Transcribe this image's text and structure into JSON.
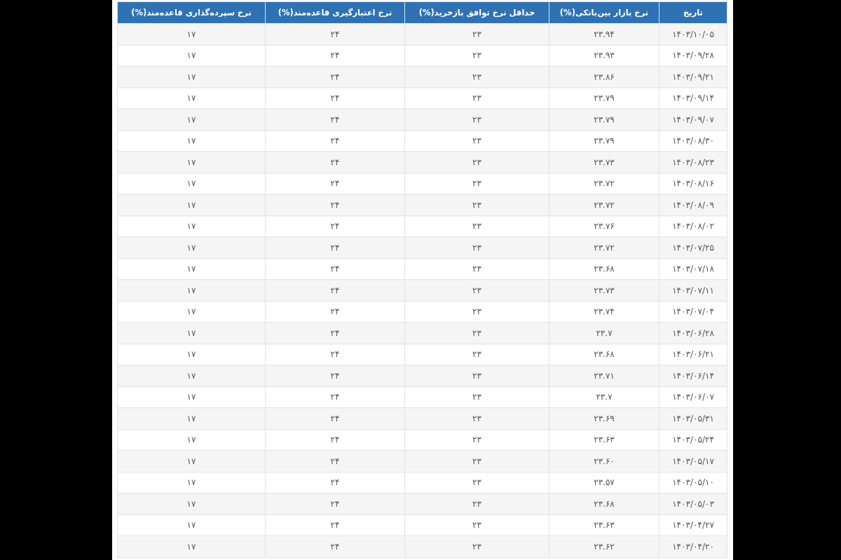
{
  "table": {
    "columns": [
      "تاریخ",
      "نرخ بازار بین‌بانکی(%)",
      "حداقل نرخ توافق بازخرید(%)",
      "نرخ اعتبارگیری قاعده‌مند(%)",
      "نرخ سپرده‌گذاری قاعده‌مند(%)"
    ],
    "rows": [
      [
        "۱۴۰۳/۱۰/۰۵",
        "۲۳.۹۴",
        "۲۳",
        "۲۴",
        "۱۷"
      ],
      [
        "۱۴۰۳/۰۹/۲۸",
        "۲۳.۹۳",
        "۲۳",
        "۲۴",
        "۱۷"
      ],
      [
        "۱۴۰۳/۰۹/۲۱",
        "۲۳.۸۶",
        "۲۳",
        "۲۴",
        "۱۷"
      ],
      [
        "۱۴۰۳/۰۹/۱۴",
        "۲۳.۷۹",
        "۲۳",
        "۲۴",
        "۱۷"
      ],
      [
        "۱۴۰۳/۰۹/۰۷",
        "۲۳.۷۹",
        "۲۳",
        "۲۴",
        "۱۷"
      ],
      [
        "۱۴۰۳/۰۸/۳۰",
        "۲۳.۷۹",
        "۲۳",
        "۲۴",
        "۱۷"
      ],
      [
        "۱۴۰۳/۰۸/۲۳",
        "۲۳.۷۳",
        "۲۳",
        "۲۴",
        "۱۷"
      ],
      [
        "۱۴۰۳/۰۸/۱۶",
        "۲۳.۷۲",
        "۲۳",
        "۲۴",
        "۱۷"
      ],
      [
        "۱۴۰۳/۰۸/۰۹",
        "۲۳.۷۲",
        "۲۳",
        "۲۴",
        "۱۷"
      ],
      [
        "۱۴۰۳/۰۸/۰۲",
        "۲۳.۷۶",
        "۲۳",
        "۲۴",
        "۱۷"
      ],
      [
        "۱۴۰۳/۰۷/۲۵",
        "۲۳.۷۲",
        "۲۳",
        "۲۴",
        "۱۷"
      ],
      [
        "۱۴۰۳/۰۷/۱۸",
        "۲۳.۶۸",
        "۲۳",
        "۲۴",
        "۱۷"
      ],
      [
        "۱۴۰۳/۰۷/۱۱",
        "۲۳.۷۳",
        "۲۳",
        "۲۴",
        "۱۷"
      ],
      [
        "۱۴۰۳/۰۷/۰۴",
        "۲۳.۷۴",
        "۲۳",
        "۲۴",
        "۱۷"
      ],
      [
        "۱۴۰۳/۰۶/۲۸",
        "۲۳.۷",
        "۲۳",
        "۲۴",
        "۱۷"
      ],
      [
        "۱۴۰۳/۰۶/۲۱",
        "۲۳.۶۸",
        "۲۳",
        "۲۴",
        "۱۷"
      ],
      [
        "۱۴۰۳/۰۶/۱۴",
        "۲۳.۷۱",
        "۲۳",
        "۲۴",
        "۱۷"
      ],
      [
        "۱۴۰۳/۰۶/۰۷",
        "۲۳.۷",
        "۲۳",
        "۲۴",
        "۱۷"
      ],
      [
        "۱۴۰۳/۰۵/۳۱",
        "۲۳.۶۹",
        "۲۳",
        "۲۴",
        "۱۷"
      ],
      [
        "۱۴۰۳/۰۵/۲۴",
        "۲۳.۶۳",
        "۲۳",
        "۲۴",
        "۱۷"
      ],
      [
        "۱۴۰۳/۰۵/۱۷",
        "۲۳.۶۰",
        "۲۳",
        "۲۴",
        "۱۷"
      ],
      [
        "۱۴۰۳/۰۵/۱۰",
        "۲۳.۵۷",
        "۲۳",
        "۲۴",
        "۱۷"
      ],
      [
        "۱۴۰۳/۰۵/۰۳",
        "۲۳.۶۸",
        "۲۳",
        "۲۴",
        "۱۷"
      ],
      [
        "۱۴۰۳/۰۴/۲۷",
        "۲۳.۶۳",
        "۲۳",
        "۲۴",
        "۱۷"
      ],
      [
        "۱۴۰۳/۰۴/۲۰",
        "۲۳.۶۲",
        "۲۳",
        "۲۴",
        "۱۷"
      ]
    ]
  }
}
